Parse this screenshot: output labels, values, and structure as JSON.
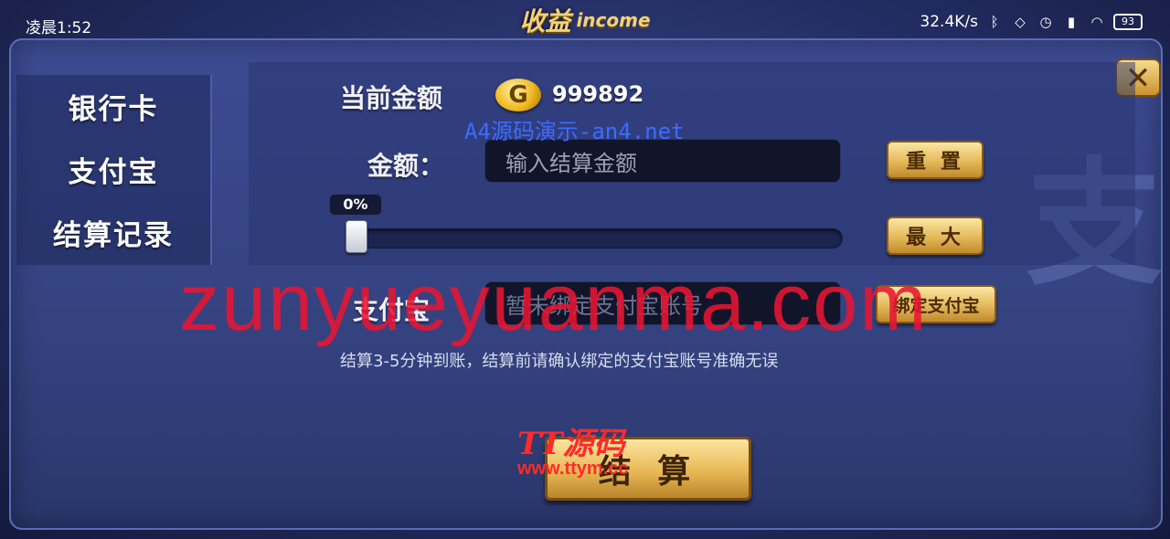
{
  "status_bar": {
    "time": "凌晨1:52",
    "network_speed": "32.4K/s",
    "battery": "93",
    "icons": [
      "bluetooth-icon",
      "mute-icon",
      "alarm-icon",
      "signal-icon",
      "wifi-icon",
      "battery-icon"
    ]
  },
  "title": {
    "cn": "收益",
    "en": "income"
  },
  "close_label": "✕",
  "sidebar": {
    "items": [
      {
        "label": "银行卡"
      },
      {
        "label": "支付宝"
      },
      {
        "label": "结算记录"
      }
    ]
  },
  "balance": {
    "label": "当前金额",
    "coin_glyph": "G",
    "value": "999892"
  },
  "amount": {
    "label": "金额：",
    "placeholder": "输入结算金额",
    "reset_label": "重 置"
  },
  "slider": {
    "percent_label": "0%",
    "value": 0,
    "max_label": "最 大"
  },
  "alipay": {
    "label": "支付宝",
    "placeholder": "暂未绑定支付宝账号",
    "bind_label": "绑定支付宝"
  },
  "note": "结算3-5分钟到账，结算前请确认绑定的支付宝账号准确无误",
  "settle_label": "结 算",
  "bg_glyph": "支",
  "watermarks": {
    "a4": "A4源码演示-an4.net",
    "big": "zunyueyuanma.com",
    "tt": "TT源码",
    "tt_url": "www.ttym.cc"
  },
  "colors": {
    "gold": "#e4b95a",
    "panel": "#34427f",
    "input_bg": "#10152a"
  }
}
